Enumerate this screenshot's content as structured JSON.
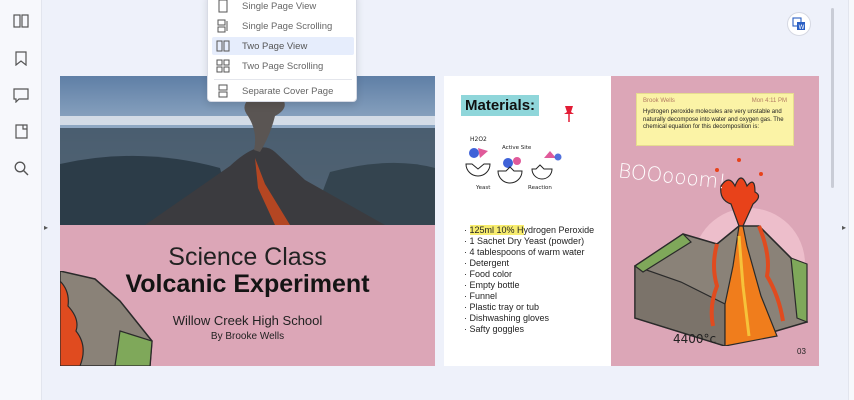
{
  "view_menu": {
    "items": [
      {
        "label": "Single Page View",
        "selected": false
      },
      {
        "label": "Single Page Scrolling",
        "selected": false
      },
      {
        "label": "Two Page View",
        "selected": true
      },
      {
        "label": "Two Page Scrolling",
        "selected": false
      },
      {
        "label": "Separate Cover Page",
        "selected": false
      }
    ]
  },
  "left_toolbar": {
    "icons": [
      "two-page-icon",
      "bookmark-icon",
      "comment-icon",
      "page-thumbnail-icon",
      "search-icon"
    ]
  },
  "cover_page": {
    "subtitle": "Science Class",
    "title": "Volcanic Experiment",
    "school": "Willow Creek High School",
    "author": "By Brooke Wells"
  },
  "materials_page": {
    "heading": "Materials:",
    "sketch_labels": {
      "formula": "H2O2",
      "site": "Active Site",
      "yeast": "Yeast",
      "reaction": "Reaction"
    },
    "items_first_highlight": "125ml 10% H",
    "items_first_rest": "ydrogen Peroxide",
    "items": [
      "1 Sachet Dry Yeast (powder)",
      "4 tablespoons of warm water",
      "Detergent",
      "Food color",
      "Empty bottle",
      "Funnel",
      "Plastic tray or tub",
      "Dishwashing gloves",
      "Safty goggles"
    ]
  },
  "note": {
    "author": "Brook Wells",
    "time": "Mon 4:11 PM",
    "text": "Hydrogen peroxide molecules are very unstable and naturally decompose into water and oxygen gas. The chemical equation for this decomposition is:"
  },
  "illustration_page": {
    "sound": "BOOooom!",
    "temperature": "4400°c",
    "page_number": "03"
  },
  "colors": {
    "page_pink": "#dca6b7",
    "heading_bg": "#8fd6da",
    "highlight": "#f7ec6e",
    "menu_selected": "#e6edfc"
  }
}
